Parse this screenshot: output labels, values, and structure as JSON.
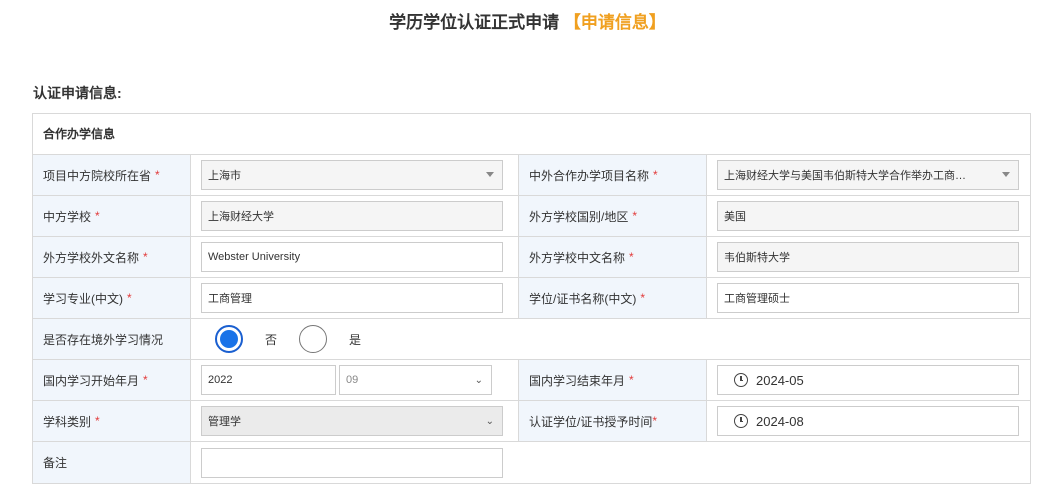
{
  "header": {
    "title": "学历学位认证正式申请",
    "title_highlight": "【申请信息】"
  },
  "section_label": "认证申请信息:",
  "panel": {
    "title": "合作办学信息"
  },
  "required_mark": "*",
  "fields": {
    "province": {
      "label": "项目中方院校所在省",
      "value": "上海市"
    },
    "project_name": {
      "label": "中外合作办学项目名称",
      "value": "上海财经大学与美国韦伯斯特大学合作举办工商…"
    },
    "cn_school": {
      "label": "中方学校",
      "value": "上海财经大学"
    },
    "foreign_country": {
      "label": "外方学校国别/地区",
      "value": "美国"
    },
    "foreign_name_en": {
      "label": "外方学校外文名称",
      "value": "Webster University"
    },
    "foreign_name_cn": {
      "label": "外方学校中文名称",
      "value": "韦伯斯特大学"
    },
    "major": {
      "label": "学习专业(中文)",
      "value": "工商管理"
    },
    "degree_name": {
      "label": "学位/证书名称(中文)",
      "value": "工商管理硕士"
    },
    "overseas_study": {
      "label": "是否存在境外学习情况",
      "option_no": "否",
      "option_yes": "是",
      "selected": "否"
    },
    "start_date": {
      "label": "国内学习开始年月",
      "year": "2022",
      "month": "09"
    },
    "end_date": {
      "label": "国内学习结束年月",
      "value": "2024-05"
    },
    "subject": {
      "label": "学科类别",
      "value": "管理学"
    },
    "award_date": {
      "label": "认证学位/证书授予时间",
      "value": "2024-08"
    },
    "remark": {
      "label": "备注",
      "value": ""
    }
  }
}
